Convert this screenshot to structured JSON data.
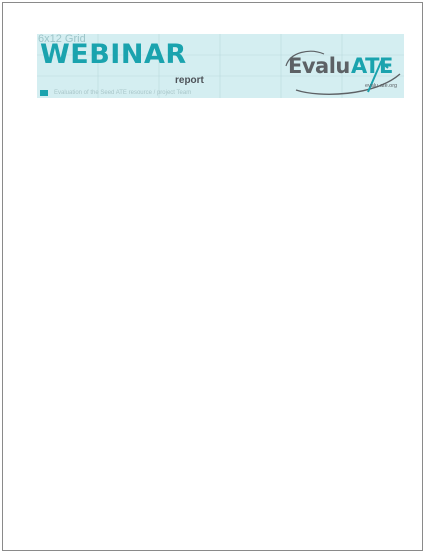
{
  "banner": {
    "grid_label": "6x12 Grid",
    "title": "WEBINAR",
    "subtitle": "report",
    "faint_line": "Evaluation of the Seed ATE resource / project Team",
    "logo": {
      "prefix": "Evalu",
      "suffix": "ATE",
      "url": "evalu-ate.org"
    }
  },
  "colors": {
    "accent": "#1aa3ae",
    "banner_bg": "#d4eef1",
    "logo_gray": "#5d6165"
  }
}
